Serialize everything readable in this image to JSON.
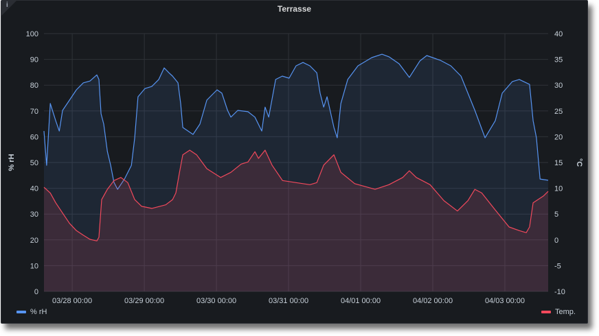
{
  "panel": {
    "title": "Terrasse",
    "info_icon": "info-icon"
  },
  "chart_data": {
    "type": "line",
    "title": "Terrasse",
    "x_unit": "hours since 03/28 00:00",
    "xlim": [
      -9.4,
      158.4
    ],
    "x_ticks": [
      {
        "h": 0,
        "label": "03/28 00:00"
      },
      {
        "h": 24,
        "label": "03/29 00:00"
      },
      {
        "h": 48,
        "label": "03/30 00:00"
      },
      {
        "h": 72,
        "label": "03/31 00:00"
      },
      {
        "h": 96,
        "label": "04/01 00:00"
      },
      {
        "h": 120,
        "label": "04/02 00:00"
      },
      {
        "h": 144,
        "label": "04/03 00:00"
      }
    ],
    "y_left": {
      "label": "% rH",
      "ylim": [
        0,
        100
      ],
      "ticks": [
        "0",
        "10",
        "20",
        "30",
        "40",
        "50",
        "60",
        "70",
        "80",
        "90",
        "100"
      ]
    },
    "y_right": {
      "label": "°C",
      "ylim": [
        -10,
        40
      ],
      "ticks": [
        "-10",
        "-5",
        "0",
        "5",
        "10",
        "15",
        "20",
        "25",
        "30",
        "35",
        "40"
      ]
    },
    "grid": true,
    "series": [
      {
        "name": "% rH",
        "axis": "left",
        "color": "#5794F2",
        "legend_position": "bottom-left",
        "points": [
          [
            -9.4,
            62.2
          ],
          [
            -8.5,
            48.9
          ],
          [
            -7.3,
            72.9
          ],
          [
            -5.5,
            66.2
          ],
          [
            -4.3,
            62.2
          ],
          [
            -3.2,
            70.2
          ],
          [
            -0.9,
            74.2
          ],
          [
            1.4,
            78.2
          ],
          [
            3.7,
            80.9
          ],
          [
            5.9,
            81.6
          ],
          [
            8.2,
            84.0
          ],
          [
            8.9,
            82.2
          ],
          [
            9.6,
            68.9
          ],
          [
            10.5,
            64.9
          ],
          [
            11.7,
            54.3
          ],
          [
            12.8,
            48.9
          ],
          [
            13.9,
            42.3
          ],
          [
            15.1,
            39.6
          ],
          [
            17.4,
            43.6
          ],
          [
            19.7,
            48.9
          ],
          [
            20.8,
            59.6
          ],
          [
            21.9,
            75.5
          ],
          [
            24.2,
            78.7
          ],
          [
            26.5,
            79.5
          ],
          [
            28.8,
            82.2
          ],
          [
            30.6,
            86.7
          ],
          [
            32.2,
            84.8
          ],
          [
            33.4,
            83.5
          ],
          [
            35.2,
            80.9
          ],
          [
            36.1,
            72.9
          ],
          [
            36.8,
            63.6
          ],
          [
            40.2,
            60.9
          ],
          [
            42.5,
            64.9
          ],
          [
            44.8,
            74.2
          ],
          [
            48.2,
            78.2
          ],
          [
            49.8,
            76.9
          ],
          [
            51.7,
            70.2
          ],
          [
            52.8,
            67.6
          ],
          [
            55.1,
            70.2
          ],
          [
            58.5,
            69.7
          ],
          [
            60.8,
            67.6
          ],
          [
            63.1,
            62.2
          ],
          [
            64.2,
            71.5
          ],
          [
            65.4,
            67.6
          ],
          [
            67.7,
            82.2
          ],
          [
            69.9,
            83.5
          ],
          [
            72.2,
            82.7
          ],
          [
            74.5,
            87.5
          ],
          [
            76.8,
            88.8
          ],
          [
            79.1,
            87.5
          ],
          [
            81.4,
            84.8
          ],
          [
            82.5,
            76.9
          ],
          [
            83.7,
            71.5
          ],
          [
            84.8,
            75.5
          ],
          [
            87.1,
            63.6
          ],
          [
            88.2,
            59.6
          ],
          [
            89.4,
            72.9
          ],
          [
            91.7,
            82.2
          ],
          [
            95.1,
            87.5
          ],
          [
            99.7,
            90.7
          ],
          [
            103.1,
            92.0
          ],
          [
            105.4,
            91.0
          ],
          [
            108.8,
            88.3
          ],
          [
            112.2,
            83.0
          ],
          [
            115.7,
            89.4
          ],
          [
            118.0,
            91.5
          ],
          [
            122.6,
            89.6
          ],
          [
            126.0,
            87.5
          ],
          [
            129.4,
            83.5
          ],
          [
            134.0,
            70.2
          ],
          [
            137.4,
            59.6
          ],
          [
            140.8,
            66.2
          ],
          [
            143.1,
            76.9
          ],
          [
            146.5,
            81.4
          ],
          [
            148.8,
            82.2
          ],
          [
            152.2,
            80.3
          ],
          [
            153.4,
            66.2
          ],
          [
            154.5,
            59.6
          ],
          [
            155.7,
            43.6
          ],
          [
            158.4,
            43.1
          ]
        ]
      },
      {
        "name": "Temp.",
        "axis": "right",
        "color": "#F2495C",
        "legend_position": "bottom-right",
        "points": [
          [
            -9.4,
            10.2
          ],
          [
            -7.3,
            9.1
          ],
          [
            -5.5,
            7.2
          ],
          [
            -3.2,
            5.2
          ],
          [
            -0.9,
            3.2
          ],
          [
            1.4,
            1.8
          ],
          [
            3.7,
            0.9
          ],
          [
            5.9,
            0.1
          ],
          [
            8.2,
            -0.2
          ],
          [
            8.9,
            0.5
          ],
          [
            9.8,
            7.8
          ],
          [
            11.7,
            9.8
          ],
          [
            13.9,
            11.5
          ],
          [
            16.2,
            12.1
          ],
          [
            18.5,
            11.1
          ],
          [
            20.8,
            7.8
          ],
          [
            23.1,
            6.5
          ],
          [
            26.5,
            6.1
          ],
          [
            31.1,
            6.8
          ],
          [
            33.4,
            7.8
          ],
          [
            34.5,
            9.1
          ],
          [
            35.7,
            13.1
          ],
          [
            36.8,
            16.5
          ],
          [
            39.1,
            17.4
          ],
          [
            41.4,
            16.5
          ],
          [
            44.8,
            13.8
          ],
          [
            49.4,
            12.1
          ],
          [
            52.8,
            13.1
          ],
          [
            56.2,
            14.7
          ],
          [
            58.5,
            15.1
          ],
          [
            60.8,
            17.1
          ],
          [
            62.0,
            15.8
          ],
          [
            64.2,
            17.4
          ],
          [
            66.5,
            14.5
          ],
          [
            70.0,
            11.5
          ],
          [
            74.5,
            11.1
          ],
          [
            79.1,
            10.7
          ],
          [
            81.4,
            11.1
          ],
          [
            83.7,
            14.5
          ],
          [
            87.1,
            16.5
          ],
          [
            89.4,
            13.1
          ],
          [
            94.0,
            10.9
          ],
          [
            100.8,
            9.8
          ],
          [
            105.4,
            10.7
          ],
          [
            110.0,
            12.1
          ],
          [
            112.2,
            13.4
          ],
          [
            114.5,
            12.1
          ],
          [
            119.1,
            10.7
          ],
          [
            123.7,
            7.6
          ],
          [
            128.2,
            5.6
          ],
          [
            131.7,
            7.6
          ],
          [
            134.0,
            9.8
          ],
          [
            136.3,
            9.1
          ],
          [
            140.8,
            5.8
          ],
          [
            145.4,
            2.5
          ],
          [
            148.8,
            1.8
          ],
          [
            151.1,
            1.4
          ],
          [
            152.2,
            2.5
          ],
          [
            153.4,
            7.2
          ],
          [
            156.8,
            8.5
          ],
          [
            158.4,
            9.4
          ]
        ]
      }
    ]
  },
  "legend": {
    "humidity": "% rH",
    "temp": "Temp."
  }
}
